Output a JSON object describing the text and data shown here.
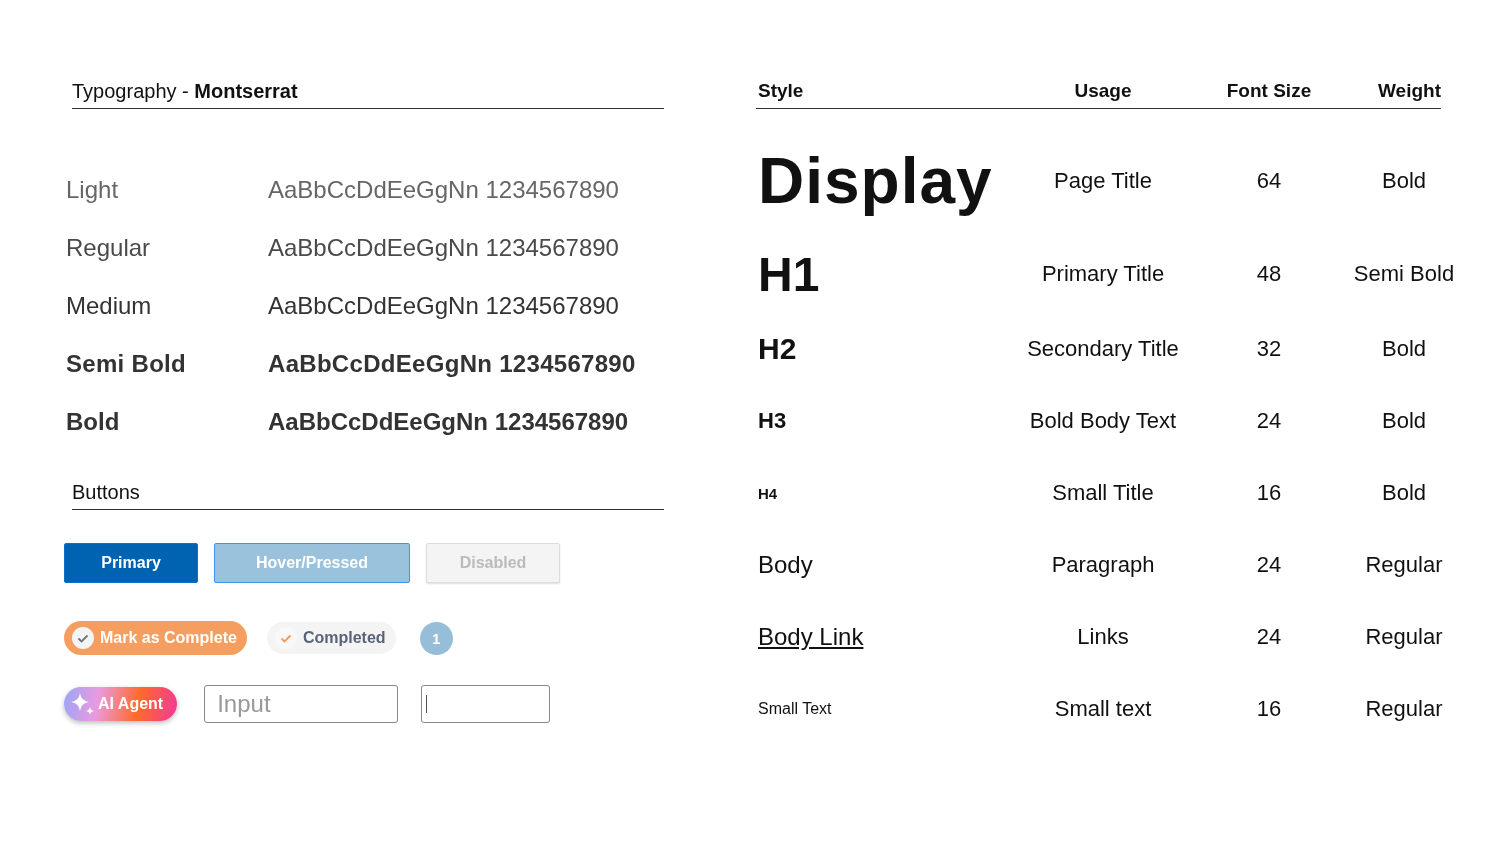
{
  "typography": {
    "title": "Typography - **Montserrat**",
    "weights": [
      {
        "kind": "light",
        "label": "Light",
        "sample": "AaBbCcDdEeGgNn 1234567890"
      },
      {
        "kind": "regular",
        "label": "Regular",
        "sample": "AaBbCcDdEeGgNn 1234567890"
      },
      {
        "kind": "medium",
        "label": "Medium",
        "sample": "AaBbCcDdEeGgNn 1234567890"
      },
      {
        "kind": "semibold",
        "label": "Semi Bold",
        "sample": "AaBbCcDdEeGgNn 1234567890"
      },
      {
        "kind": "bold",
        "label": "Bold",
        "sample": "AaBbCcDdEeGgNn 1234567890"
      }
    ]
  },
  "buttons": {
    "title": "Buttons",
    "row_1": [
      {
        "kind": "primary",
        "label": "Primary"
      },
      {
        "kind": "hover",
        "label": "Hover/Pressed"
      },
      {
        "kind": "disabled",
        "label": "Disabled"
      }
    ],
    "row_2": [
      {
        "kind": "mark",
        "label": "Mark as Complete"
      },
      {
        "kind": "completed",
        "label": "Completed"
      },
      {
        "kind": "count",
        "label": "1"
      }
    ],
    "ai_button": {
      "label": "AI Agent"
    },
    "inputs": [
      {
        "placeholder": "Input",
        "focused": false
      },
      {
        "focused": true
      }
    ]
  },
  "styles_table": {
    "columns": [
      "Style",
      "Usage",
      "Font Size",
      "Weight"
    ],
    "rows": [
      {
        "kind": "display",
        "style": "Display",
        "usage": "Page Title",
        "size": "64",
        "weight": "Bold"
      },
      {
        "kind": "h1",
        "style": "H1",
        "usage": "Primary Title",
        "size": "48",
        "weight": "Semi Bold"
      },
      {
        "kind": "h2",
        "style": "H2",
        "usage": "Secondary Title",
        "size": "32",
        "weight": "Bold"
      },
      {
        "kind": "h3",
        "style": "H3",
        "usage": "Bold Body Text",
        "size": "24",
        "weight": "Bold"
      },
      {
        "kind": "h4",
        "style": "H4",
        "usage": "Small Title",
        "size": "16",
        "weight": "Bold"
      },
      {
        "kind": "body",
        "style": "Body",
        "usage": "Paragraph",
        "size": "24",
        "weight": "Regular"
      },
      {
        "kind": "link",
        "style": "Body Link",
        "usage": "Links",
        "size": "24",
        "weight": "Regular"
      },
      {
        "kind": "small",
        "style": "Small Text",
        "usage": "Small text",
        "size": "16",
        "weight": "Regular"
      }
    ]
  }
}
